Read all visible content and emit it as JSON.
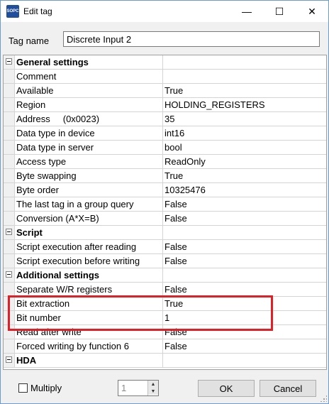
{
  "window": {
    "title": "Edit tag",
    "icon_text": "SOPC",
    "minimize_glyph": "—",
    "maximize_glyph": "☐",
    "close_glyph": "✕"
  },
  "tag": {
    "label": "Tag name",
    "value": "Discrete Input 2"
  },
  "grid": {
    "rows": [
      {
        "kind": "category",
        "name": "General settings",
        "value": ""
      },
      {
        "kind": "prop",
        "name": "Comment",
        "value": ""
      },
      {
        "kind": "prop",
        "name": "Available",
        "value": "True"
      },
      {
        "kind": "prop",
        "name": "Region",
        "value": "HOLDING_REGISTERS"
      },
      {
        "kind": "prop",
        "name": "Address     (0x0023)",
        "value": "35"
      },
      {
        "kind": "prop",
        "name": "Data type in device",
        "value": "int16"
      },
      {
        "kind": "prop",
        "name": "Data type in server",
        "value": "bool"
      },
      {
        "kind": "prop",
        "name": "Access type",
        "value": "ReadOnly"
      },
      {
        "kind": "prop",
        "name": "Byte swapping",
        "value": "True"
      },
      {
        "kind": "prop",
        "name": "Byte order",
        "value": "10325476"
      },
      {
        "kind": "prop",
        "name": "The last tag in a group query",
        "value": "False"
      },
      {
        "kind": "prop",
        "name": "Conversion (A*X=B)",
        "value": "False"
      },
      {
        "kind": "category",
        "name": "Script",
        "value": ""
      },
      {
        "kind": "prop",
        "name": "Script execution after reading",
        "value": "False"
      },
      {
        "kind": "prop",
        "name": "Script execution before writing",
        "value": "False"
      },
      {
        "kind": "category",
        "name": "Additional settings",
        "value": ""
      },
      {
        "kind": "prop",
        "name": "Separate W/R registers",
        "value": "False"
      },
      {
        "kind": "prop",
        "name": "Bit extraction",
        "value": "True"
      },
      {
        "kind": "prop",
        "name": "Bit number",
        "value": "1"
      },
      {
        "kind": "prop",
        "name": "Read after write",
        "value": "False"
      },
      {
        "kind": "prop",
        "name": "Forced writing by function 6",
        "value": "False"
      },
      {
        "kind": "category",
        "name": "HDA",
        "value": ""
      }
    ]
  },
  "footer": {
    "multiply_label": "Multiply",
    "multiply_checked": false,
    "multiplier_value": "1",
    "ok_label": "OK",
    "cancel_label": "Cancel"
  },
  "colors": {
    "highlight": "#e31e24",
    "window_border": "#6b9bd1"
  }
}
